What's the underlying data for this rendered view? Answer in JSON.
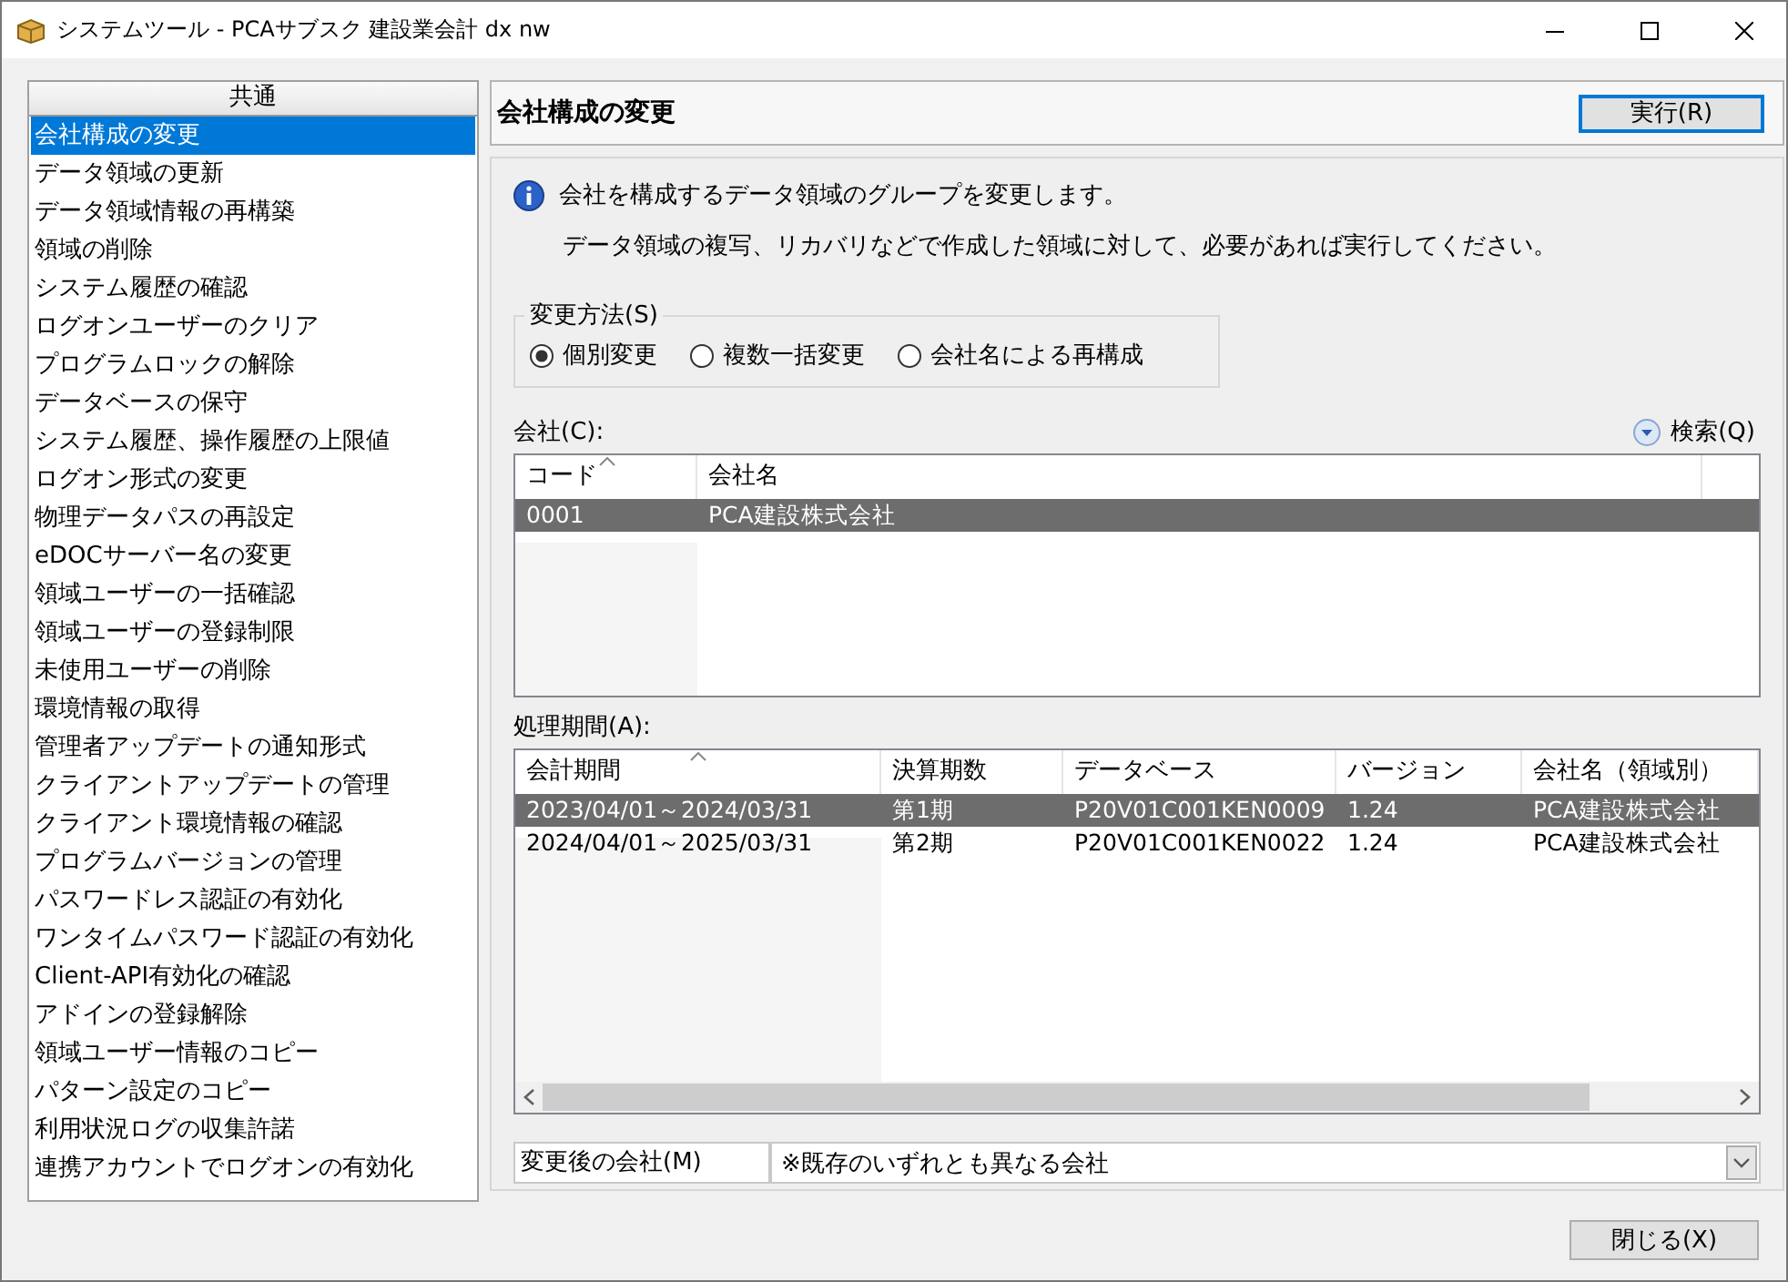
{
  "window": {
    "title": "システムツール - PCAサブスク 建設業会計 dx nw"
  },
  "sidebar": {
    "header": "共通",
    "items": [
      {
        "label": "会社構成の変更",
        "selected": true
      },
      {
        "label": "データ領域の更新",
        "selected": false
      },
      {
        "label": "データ領域情報の再構築",
        "selected": false
      },
      {
        "label": "領域の削除",
        "selected": false
      },
      {
        "label": "システム履歴の確認",
        "selected": false
      },
      {
        "label": "ログオンユーザーのクリア",
        "selected": false
      },
      {
        "label": "プログラムロックの解除",
        "selected": false
      },
      {
        "label": "データベースの保守",
        "selected": false
      },
      {
        "label": "システム履歴、操作履歴の上限値",
        "selected": false
      },
      {
        "label": "ログオン形式の変更",
        "selected": false
      },
      {
        "label": "物理データパスの再設定",
        "selected": false
      },
      {
        "label": "eDOCサーバー名の変更",
        "selected": false
      },
      {
        "label": "領域ユーザーの一括確認",
        "selected": false
      },
      {
        "label": "領域ユーザーの登録制限",
        "selected": false
      },
      {
        "label": "未使用ユーザーの削除",
        "selected": false
      },
      {
        "label": "環境情報の取得",
        "selected": false
      },
      {
        "label": "管理者アップデートの通知形式",
        "selected": false
      },
      {
        "label": "クライアントアップデートの管理",
        "selected": false
      },
      {
        "label": "クライアント環境情報の確認",
        "selected": false
      },
      {
        "label": "プログラムバージョンの管理",
        "selected": false
      },
      {
        "label": "パスワードレス認証の有効化",
        "selected": false
      },
      {
        "label": "ワンタイムパスワード認証の有効化",
        "selected": false
      },
      {
        "label": "Client-API有効化の確認",
        "selected": false
      },
      {
        "label": "アドインの登録解除",
        "selected": false
      },
      {
        "label": "領域ユーザー情報のコピー",
        "selected": false
      },
      {
        "label": "パターン設定のコピー",
        "selected": false
      },
      {
        "label": "利用状況ログの収集許諾",
        "selected": false
      },
      {
        "label": "連携アカウントでログオンの有効化",
        "selected": false
      }
    ]
  },
  "panel": {
    "title": "会社構成の変更",
    "run_button": "実行(R)",
    "info": [
      "会社を構成するデータ領域のグループを変更します。",
      "データ領域の複写、リカバリなどで作成した領域に対して、必要があれば実行してください。"
    ],
    "method": {
      "legend": "変更方法(S)",
      "options": [
        {
          "label": "個別変更",
          "selected": true
        },
        {
          "label": "複数一括変更",
          "selected": false
        },
        {
          "label": "会社名による再構成",
          "selected": false
        }
      ]
    },
    "company": {
      "label": "会社(C):",
      "search_button": "検索(Q)",
      "columns": [
        {
          "label": "コード",
          "sorted": true
        },
        {
          "label": "会社名",
          "sorted": false
        }
      ],
      "rows": [
        {
          "cells": [
            "0001",
            "PCA建設株式会社"
          ],
          "selected": true
        }
      ]
    },
    "periods": {
      "label": "処理期間(A):",
      "columns": [
        {
          "label": "会計期間",
          "sorted": true
        },
        {
          "label": "決算期数",
          "sorted": false
        },
        {
          "label": "データベース",
          "sorted": false
        },
        {
          "label": "バージョン",
          "sorted": false
        },
        {
          "label": "会社名（領域別）",
          "sorted": false
        }
      ],
      "rows": [
        {
          "cells": [
            "2023/04/01～2024/03/31",
            "第1期",
            "P20V01C001KEN0009",
            "1.24",
            "PCA建設株式会社"
          ],
          "selected": true
        },
        {
          "cells": [
            "2024/04/01～2025/03/31",
            "第2期",
            "P20V01C001KEN0022",
            "1.24",
            "PCA建設株式会社"
          ],
          "selected": false
        }
      ]
    },
    "target": {
      "label": "変更後の会社(M)",
      "value": "※既存のいずれとも異なる会社"
    }
  },
  "close_button": "閉じる(X)"
}
